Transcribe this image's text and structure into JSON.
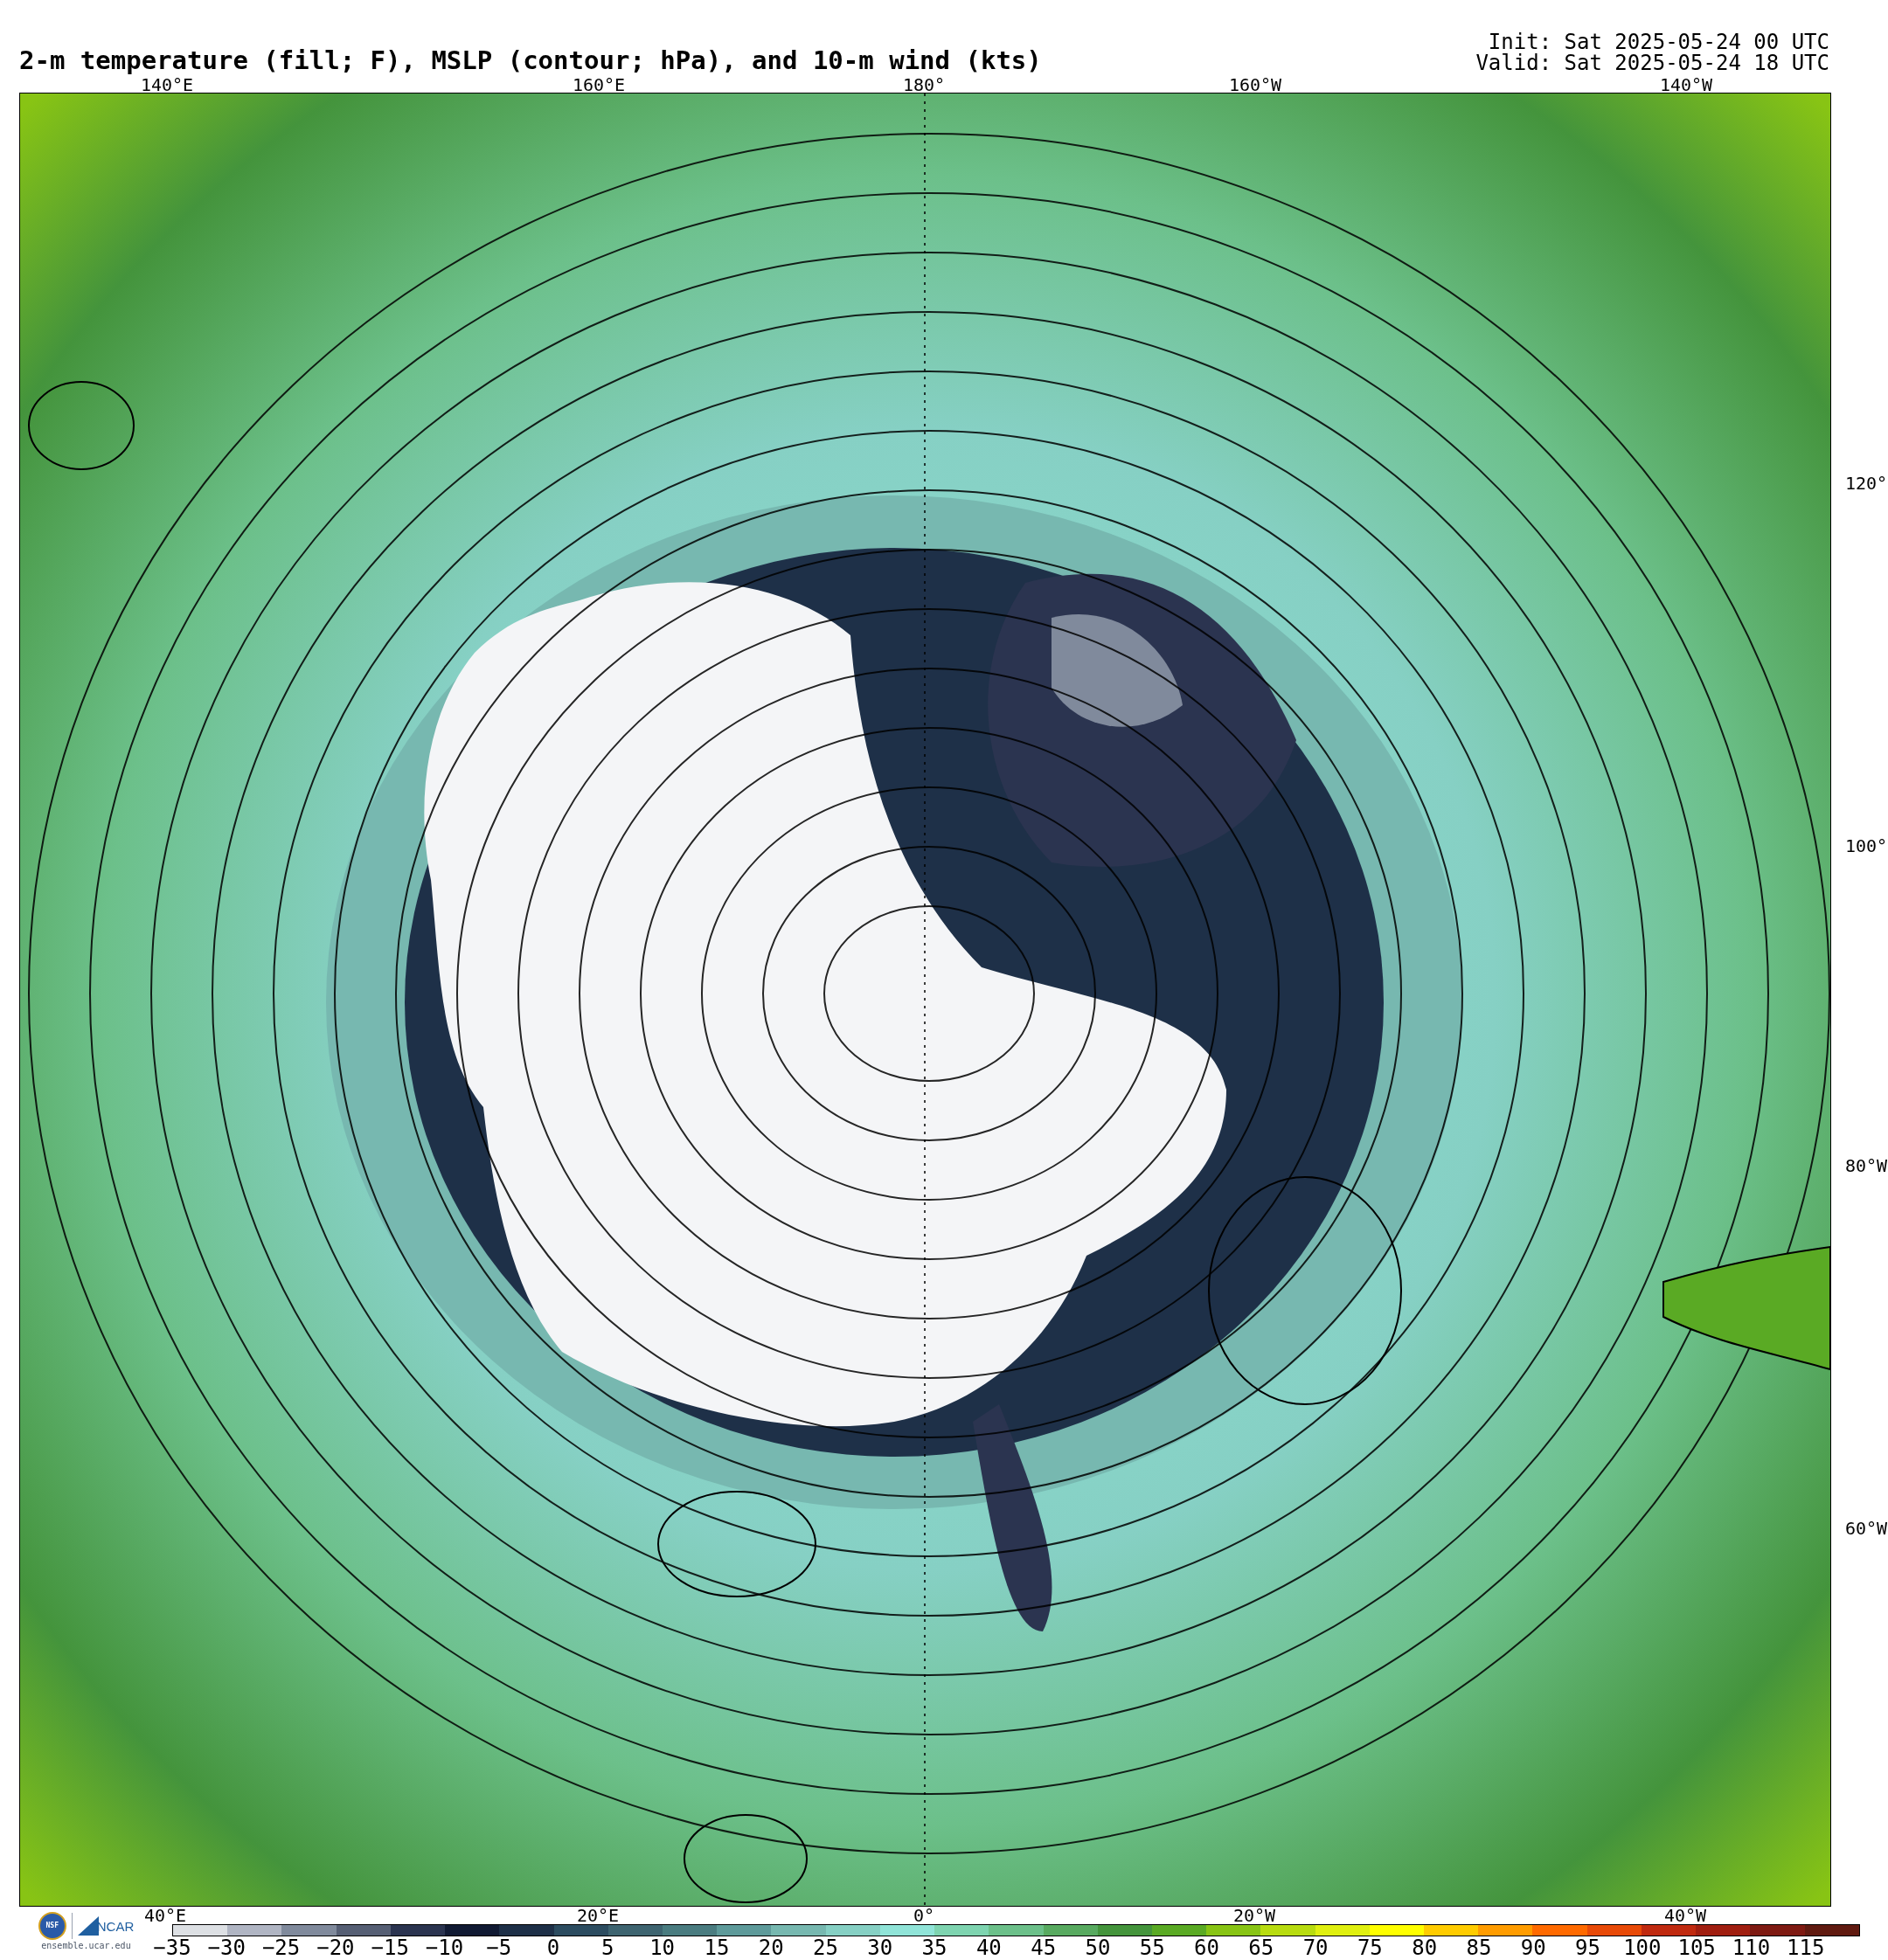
{
  "title": "2-m temperature (fill; F), MSLP (contour; hPa), and 10-m wind (kts)",
  "init": "Init: Sat 2025-05-24 00 UTC",
  "valid": "Valid: Sat 2025-05-24 18 UTC",
  "graticule_labels": {
    "top": [
      "140°E",
      "160°E",
      "180°",
      "160°W",
      "140°W"
    ],
    "right": [
      "120°",
      "100°",
      "80°W",
      "60°W"
    ],
    "bottom": [
      "40°E",
      "20°E",
      "0°",
      "20°W",
      "40°W"
    ]
  },
  "logos": {
    "nsf": "NSF",
    "ncar": "NCAR",
    "site": "ensemble.ucar.edu"
  },
  "colorbar": {
    "bins": [
      {
        "color": "#dde0e4"
      },
      {
        "color": "#b0b5c3"
      },
      {
        "color": "#808a9c"
      },
      {
        "color": "#565f74"
      },
      {
        "color": "#2b3450"
      },
      {
        "color": "#111a33"
      },
      {
        "color": "#1e3048"
      },
      {
        "color": "#2c4c60"
      },
      {
        "color": "#3e6470"
      },
      {
        "color": "#4a7c80"
      },
      {
        "color": "#5e9a9a"
      },
      {
        "color": "#77b8b0"
      },
      {
        "color": "#86d0c4"
      },
      {
        "color": "#90e4d8"
      },
      {
        "color": "#7ed4b0"
      },
      {
        "color": "#6cc08a"
      },
      {
        "color": "#58aa60"
      },
      {
        "color": "#44943c"
      },
      {
        "color": "#5aaa24"
      },
      {
        "color": "#88c414"
      },
      {
        "color": "#b8dc10"
      },
      {
        "color": "#e0f010"
      },
      {
        "color": "#ffff00"
      },
      {
        "color": "#ffcc00"
      },
      {
        "color": "#ff9c00"
      },
      {
        "color": "#ff6a00"
      },
      {
        "color": "#e84a08"
      },
      {
        "color": "#c02a10"
      },
      {
        "color": "#a01e10"
      },
      {
        "color": "#7e1a12"
      },
      {
        "color": "#601a10"
      }
    ],
    "ticks": [
      "−35",
      "−30",
      "−25",
      "−20",
      "−15",
      "−10",
      "−5",
      "0",
      "5",
      "10",
      "15",
      "20",
      "25",
      "30",
      "35",
      "40",
      "45",
      "50",
      "55",
      "60",
      "65",
      "70",
      "75",
      "80",
      "85",
      "90",
      "95",
      "100",
      "105",
      "110",
      "115"
    ]
  }
}
